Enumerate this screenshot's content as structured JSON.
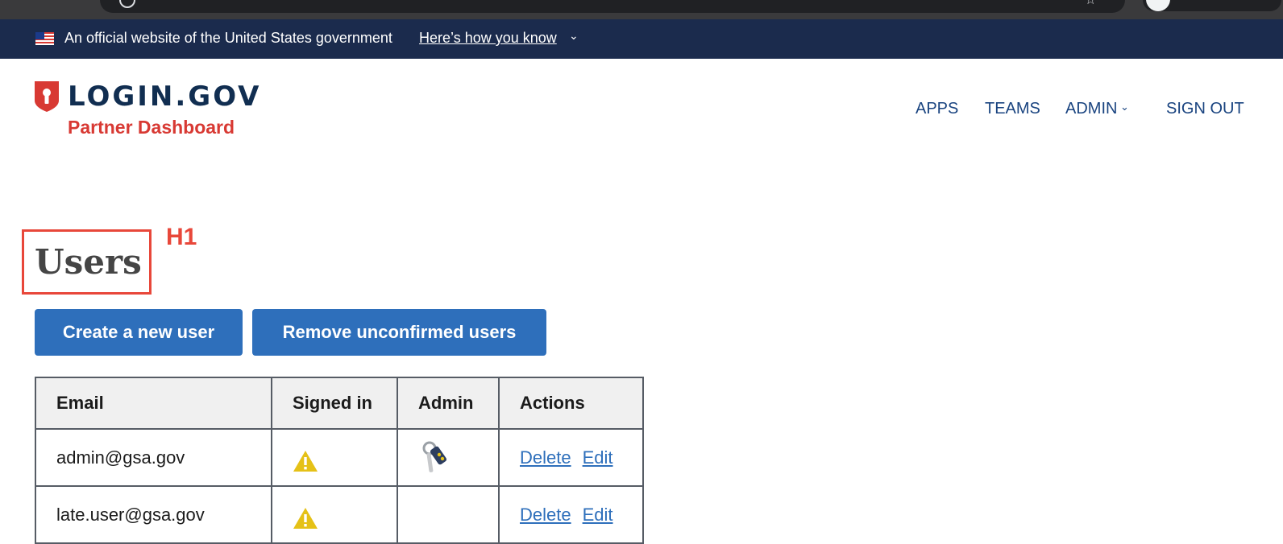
{
  "banner": {
    "text": "An official website of the United States government",
    "link": "Here’s how you know"
  },
  "header": {
    "logo_text": "LOGIN.GOV",
    "subtitle": "Partner Dashboard"
  },
  "nav": {
    "apps": "APPS",
    "teams": "TEAMS",
    "admin": "ADMIN",
    "sign_out": "SIGN OUT"
  },
  "annotation": {
    "label": "H1",
    "color": "#e8473a"
  },
  "page": {
    "title": "Users"
  },
  "buttons": {
    "create": "Create a new user",
    "remove": "Remove unconfirmed users"
  },
  "table": {
    "headers": [
      "Email",
      "Signed in",
      "Admin",
      "Actions"
    ],
    "rows": [
      {
        "email": "admin@gsa.gov",
        "signed_in_icon": "warning-icon",
        "admin_icon": "keys-icon",
        "actions": [
          "Delete",
          "Edit"
        ]
      },
      {
        "email": "late.user@gsa.gov",
        "signed_in_icon": "warning-icon",
        "admin_icon": "",
        "actions": [
          "Delete",
          "Edit"
        ]
      }
    ]
  },
  "colors": {
    "banner_bg": "#1b2b4d",
    "brand_red": "#d83933",
    "brand_navy": "#112e51",
    "primary_button": "#2e6fbb",
    "nav_link": "#1a4480"
  }
}
